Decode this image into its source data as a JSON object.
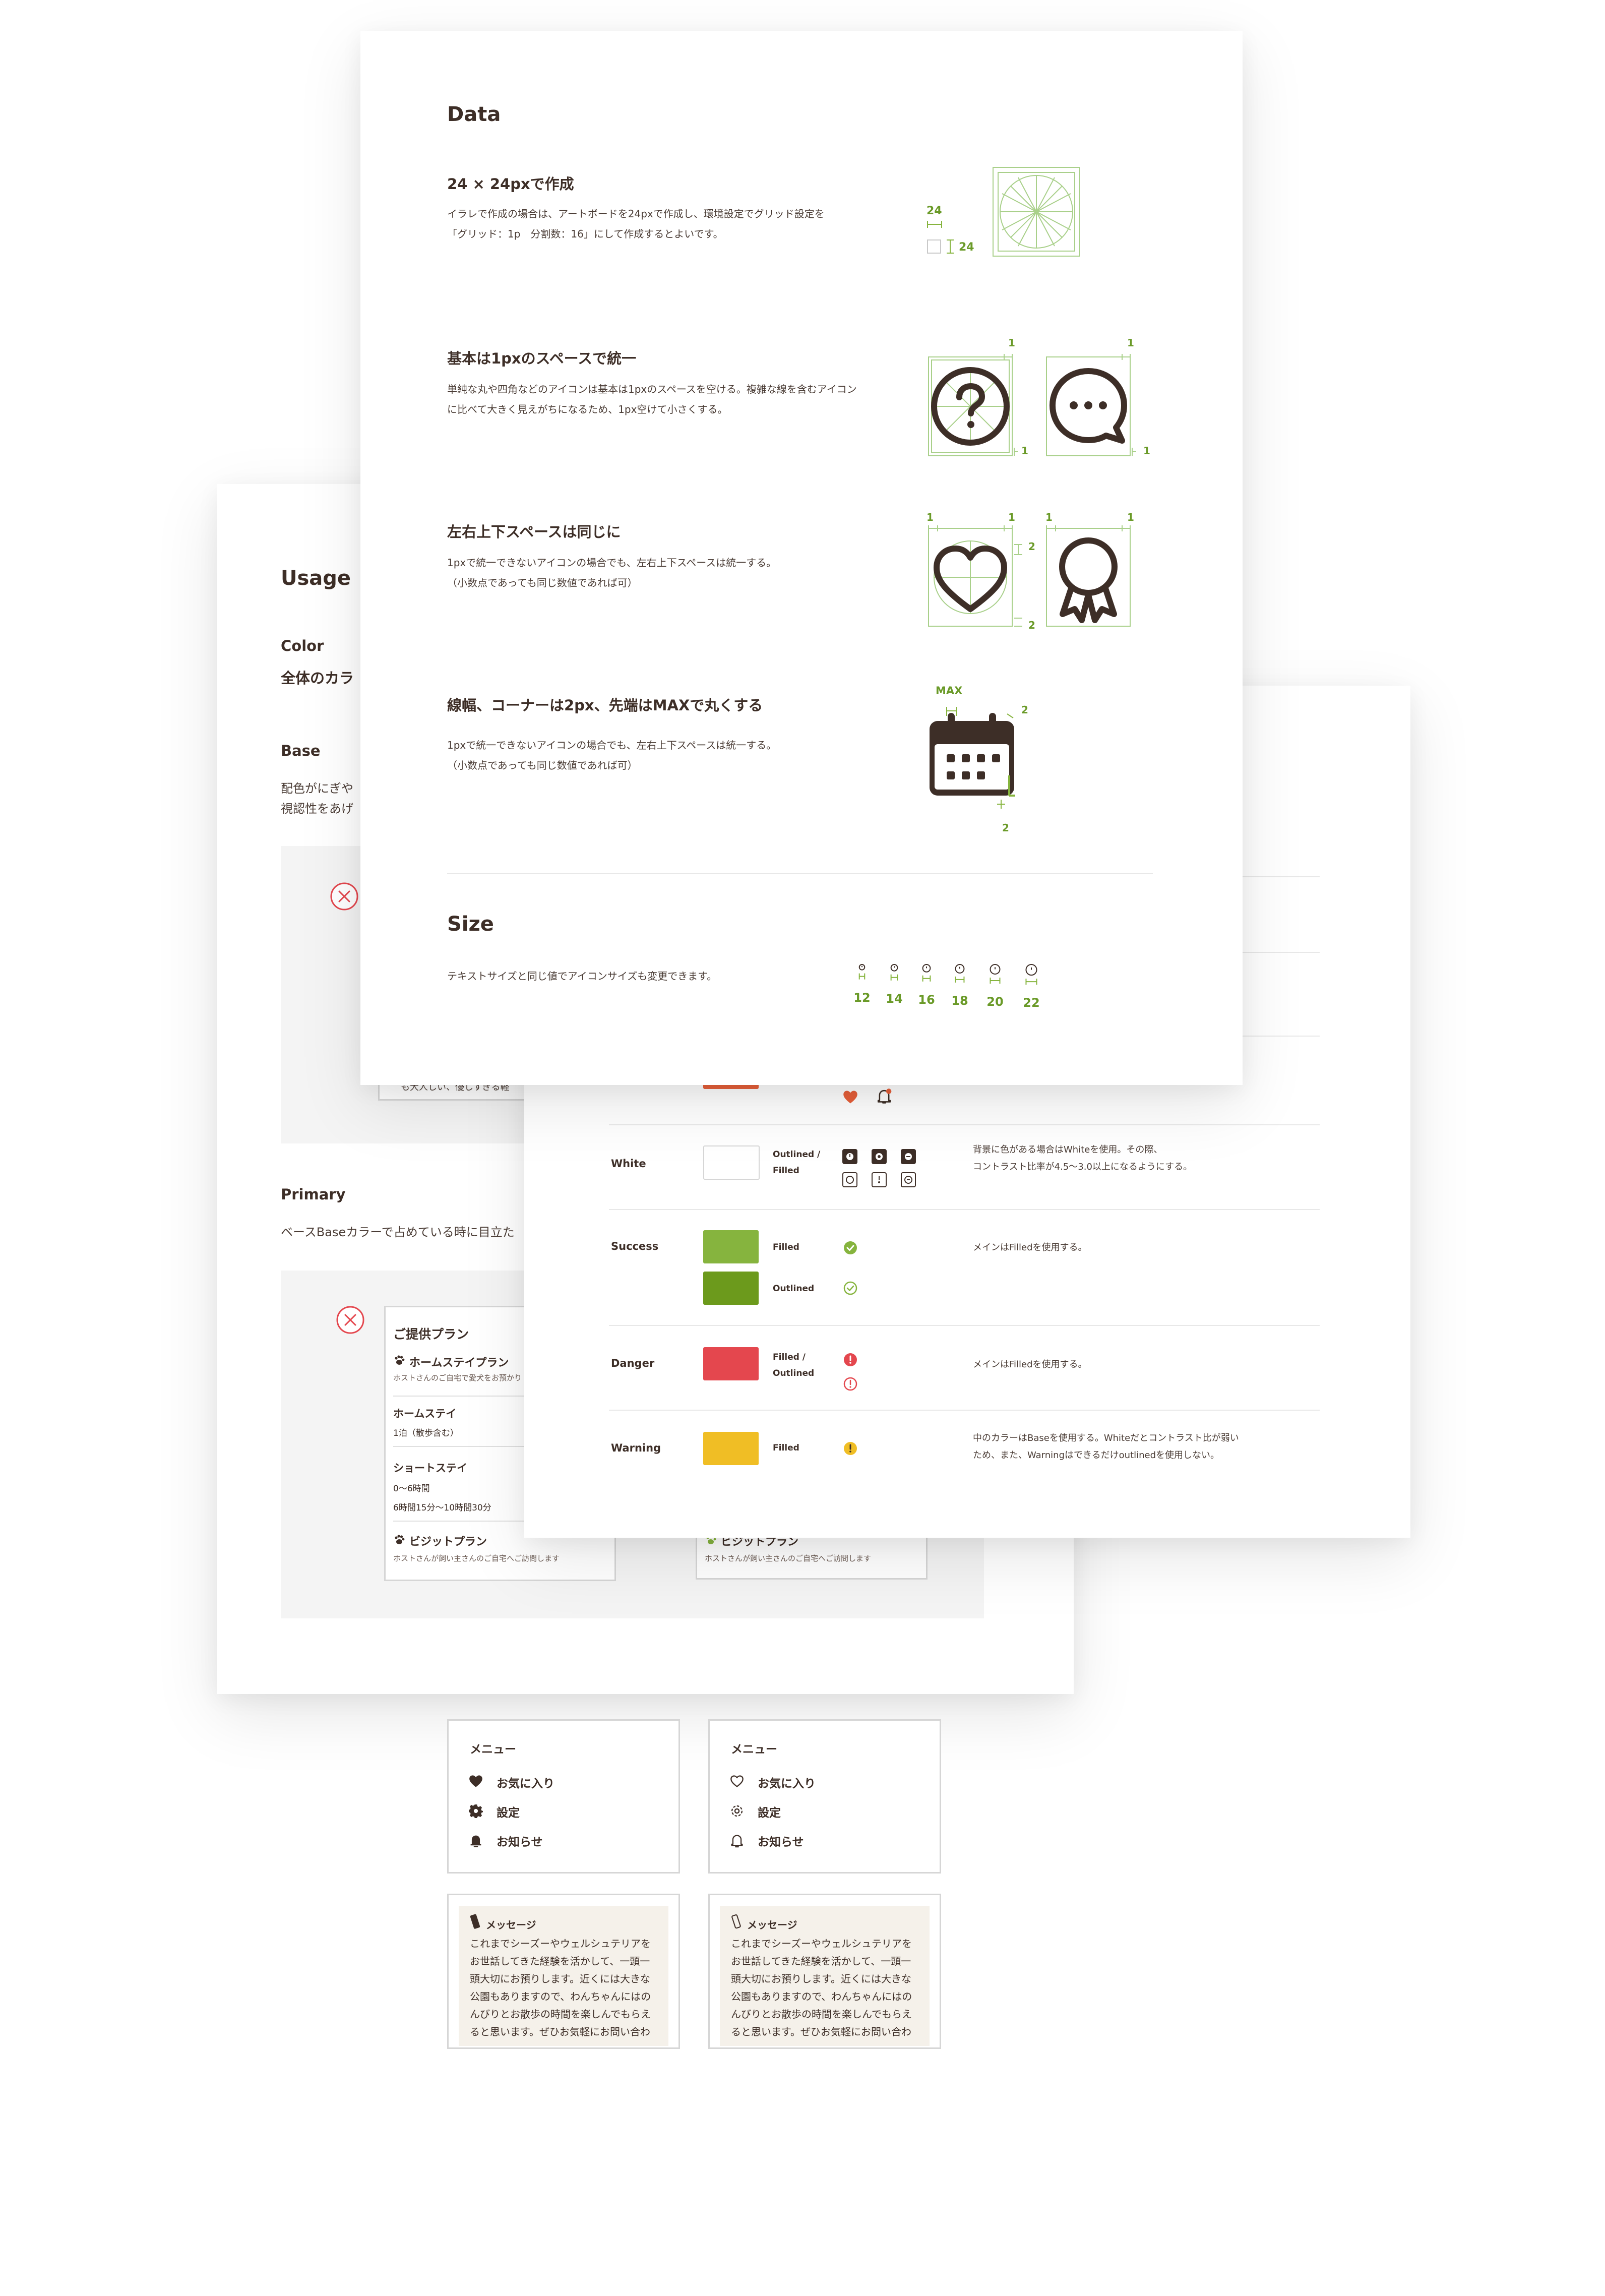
{
  "usage": {
    "title": "Usage",
    "color_heading": "Color",
    "color_desc": "全体のカラ",
    "base_heading": "Base",
    "base_desc_1": "配色がにぎや",
    "base_desc_2": "視認性をあげ",
    "base_fragment_1": "も大人しい、優しすぎる軽",
    "primary_heading": "Primary",
    "primary_desc": "ベースBaseカラーで占めている時に目立た",
    "plan_card": {
      "title": "ご提供プラン",
      "item1_title": "ホームステイプラン",
      "item1_desc": "ホストさんのご自宅で愛犬をお預かり",
      "item2_title": "ホームステイ",
      "item2_desc": "1泊（散歩含む）",
      "item3_title": "ショートステイ",
      "item3_desc1": "0〜6時間",
      "item3_desc2": "6時間15分〜10時間30分",
      "item4_title": "ビジットプラン",
      "item4_desc": "ホストさんが飼い主さんのご自宅へご訪問します"
    },
    "plan_card_right": {
      "item4_title": "ビジットプラン",
      "item4_desc": "ホストさんが飼い主さんのご自宅へご訪問します"
    }
  },
  "colors": {
    "rows": [
      {
        "label": "White",
        "type": "Outlined /\nFilled",
        "note": "背景に色がある場合はWhiteを使用。その際、\nコントラスト比率が4.5〜3.0以上になるようにする。",
        "swatch": "#ffffff"
      },
      {
        "label": "Success",
        "type": "Filled",
        "type2": "Outlined",
        "note": "メインはFilledを使用する。",
        "swatch": "#86b43e",
        "swatch2": "#6c9a1c"
      },
      {
        "label": "Danger",
        "type": "Filled /\nOutlined",
        "note": "メインはFilledを使用する。",
        "swatch": "#e4474e"
      },
      {
        "label": "Warning",
        "type": "Filled",
        "note": "中のカラーはBaseを使用する。Whiteだとコントラスト比が弱い\nため、また、Warningはできるだけoutlinedを使用しない。",
        "swatch": "#f0be25"
      }
    ],
    "accent": "#e8603a"
  },
  "data_page": {
    "title": "Data",
    "s1_title": "24 × 24pxで作成",
    "s1_desc_1": "イラレで作成の場合は、アートボードを24pxで作成し、環境設定でグリッド設定を",
    "s1_desc_2": "「グリッド：1p　分割数：16」にして作成するとよいです。",
    "s1_dim_w": "24",
    "s1_dim_h": "24",
    "s2_title": "基本は1pxのスペースで統一",
    "s2_desc_1": "単純な丸や四角などのアイコンは基本は1pxのスペースを空ける。複雑な線を含むアイコン",
    "s2_desc_2": "に比べて大きく見えがちになるため、1px空けて小さくする。",
    "s2_num": "1",
    "s3_title": "左右上下スペースは同じに",
    "s3_desc_1": "1pxで統一できないアイコンの場合でも、左右上下スペースは統一する。",
    "s3_desc_2": "（小数点であっても同じ数値であれば可）",
    "s3_num1": "1",
    "s3_num2": "2",
    "s4_title": "線幅、コーナーは2px、先端はMAXで丸くする",
    "s4_desc_1": "1pxで統一できないアイコンの場合でも、左右上下スペースは統一する。",
    "s4_desc_2": "（小数点であっても同じ数値であれば可）",
    "s4_max": "MAX",
    "s4_num": "2",
    "size_title": "Size",
    "size_desc": "テキストサイズと同じ値でアイコンサイズも変更できます。",
    "sizes": [
      "12",
      "14",
      "16",
      "18",
      "20",
      "22"
    ]
  },
  "menus": {
    "title": "メニュー",
    "items": [
      "お気に入り",
      "設定",
      "お知らせ"
    ]
  },
  "message": {
    "title": "メッセージ",
    "lines": [
      "これまでシーズーやウェルシュテリアを",
      "お世話してきた経験を活かして、一頭一",
      "頭大切にお預りします。近くには大きな",
      "公園もありますので、わんちゃんにはの",
      "んびりとお散歩の時間を楽しんでもらえ",
      "ると思います。ぜひお気軽にお問い合わ"
    ]
  },
  "theme": {
    "text": "#3d2e27",
    "green": "#6a9a28",
    "grid": "#a9d08a",
    "danger": "#e4474e",
    "warning": "#f0be25"
  }
}
